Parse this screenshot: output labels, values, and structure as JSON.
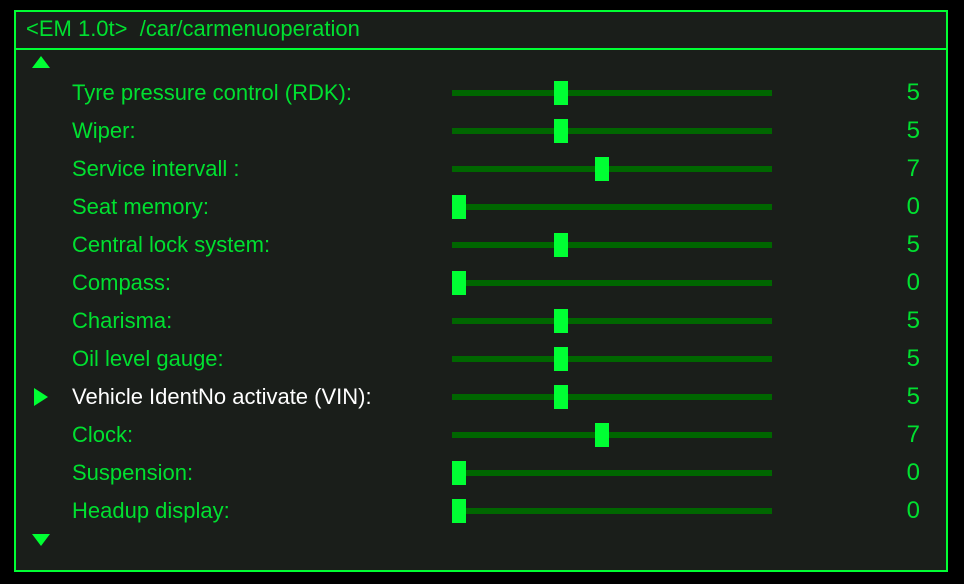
{
  "title_prefix": "<EM 1.0t>",
  "title_path": "/car/carmenuoperation",
  "slider_max": 15,
  "selected_index": 8,
  "items": [
    {
      "label": "Tyre pressure control (RDK):",
      "value": 5
    },
    {
      "label": "Wiper:",
      "value": 5
    },
    {
      "label": "Service intervall :",
      "value": 7
    },
    {
      "label": "Seat memory:",
      "value": 0
    },
    {
      "label": "Central lock system:",
      "value": 5
    },
    {
      "label": "Compass:",
      "value": 0
    },
    {
      "label": "Charisma:",
      "value": 5
    },
    {
      "label": "Oil level gauge:",
      "value": 5
    },
    {
      "label": "Vehicle IdentNo activate (VIN):",
      "value": 5
    },
    {
      "label": "Clock:",
      "value": 7
    },
    {
      "label": "Suspension:",
      "value": 0
    },
    {
      "label": "Headup display:",
      "value": 0
    }
  ]
}
